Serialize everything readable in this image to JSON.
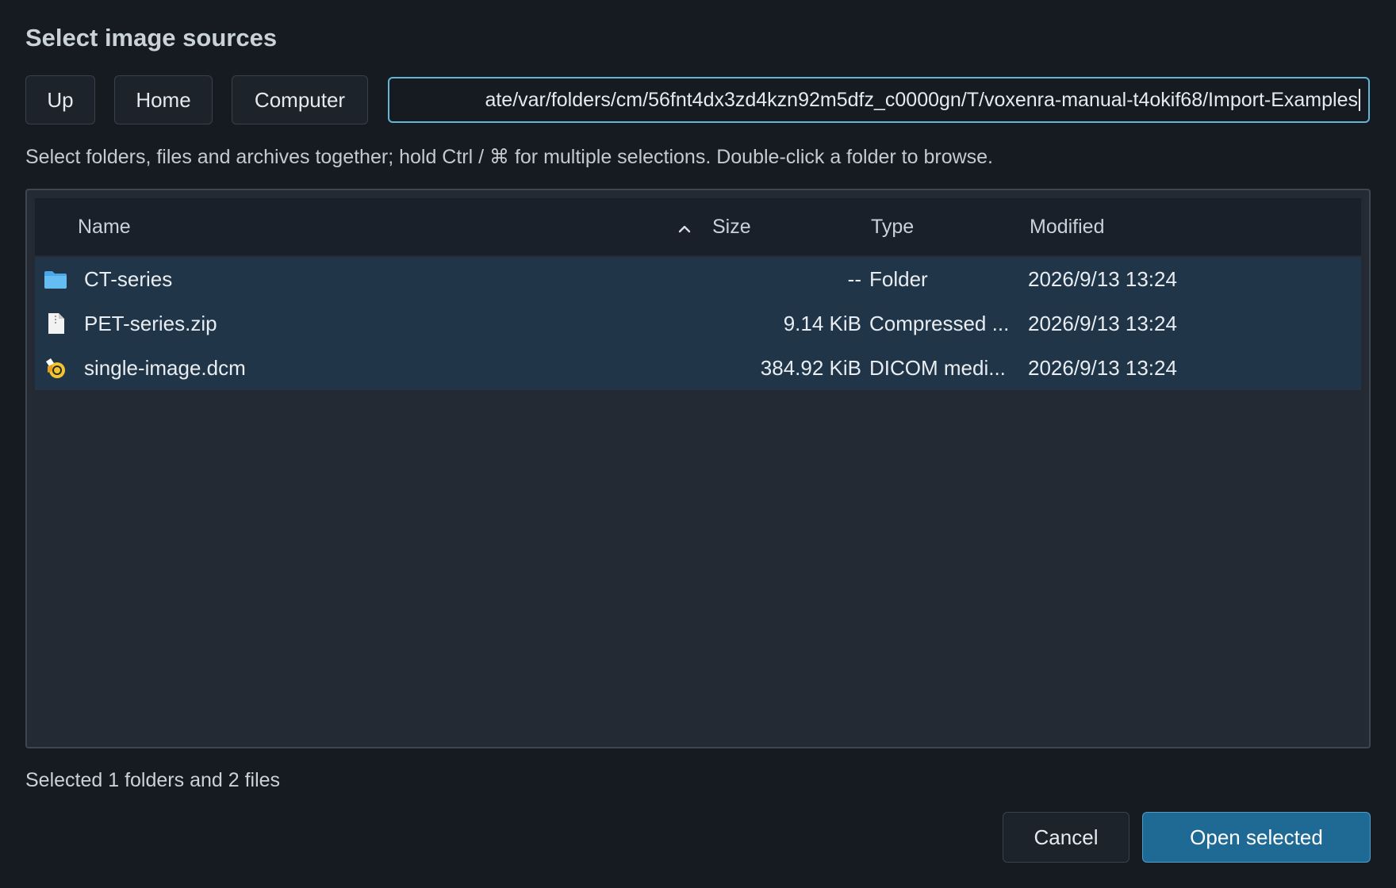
{
  "dialog": {
    "title": "Select image sources",
    "hint": "Select folders, files and archives together; hold Ctrl / ⌘ for multiple selections. Double-click a folder to browse.",
    "status": "Selected 1 folders and 2 files"
  },
  "toolbar": {
    "up_label": "Up",
    "home_label": "Home",
    "computer_label": "Computer"
  },
  "path": {
    "value": "ate/var/folders/cm/56fnt4dx3zd4kzn92m5dfz_c0000gn/T/voxenra-manual-t4okif68/Import-Examples"
  },
  "table": {
    "columns": {
      "name": "Name",
      "size": "Size",
      "type": "Type",
      "modified": "Modified"
    },
    "sort": {
      "column": "name",
      "direction": "ascending",
      "icon": "chevron-up-icon"
    },
    "rows": [
      {
        "name": "CT-series",
        "size": "--",
        "type": "Folder",
        "modified": "2026/9/13 13:24",
        "icon": "folder-icon",
        "selected": true
      },
      {
        "name": "PET-series.zip",
        "size": "9.14 KiB",
        "type": "Compressed ...",
        "modified": "2026/9/13 13:24",
        "icon": "file-icon",
        "selected": true
      },
      {
        "name": "single-image.dcm",
        "size": "384.92 KiB",
        "type": "DICOM medi...",
        "modified": "2026/9/13 13:24",
        "icon": "dicom-file-icon",
        "selected": true
      }
    ]
  },
  "footer": {
    "cancel_label": "Cancel",
    "open_label": "Open selected"
  },
  "colors": {
    "background": "#161b22",
    "panel": "#232a33",
    "selected_row": "#203648",
    "accent": "#1f6a94",
    "focus_border": "#64b4d8"
  }
}
